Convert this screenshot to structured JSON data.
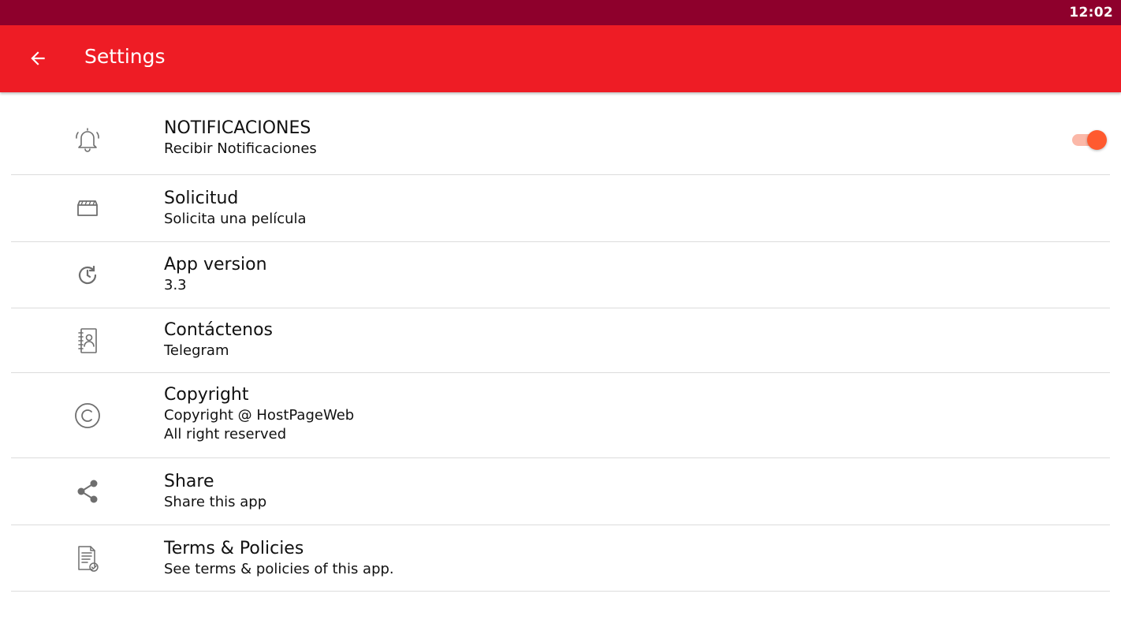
{
  "status_bar": {
    "time": "12:02"
  },
  "app_bar": {
    "back_icon": "arrow-back-icon",
    "title": "Settings"
  },
  "colors": {
    "status_bar": "#8e002c",
    "app_bar": "#ee1c25",
    "toggle_thumb": "#ff5a2f",
    "toggle_track": "#fbb8a8"
  },
  "settings": {
    "items": [
      {
        "icon": "bell-icon",
        "title": "NOTIFICACIONES",
        "subtitle": "Recibir Notificaciones",
        "toggle_on": true
      },
      {
        "icon": "movie-clapper-icon",
        "title": "Solicitud",
        "subtitle": "Solicita una película"
      },
      {
        "icon": "update-clock-icon",
        "title": "App version",
        "subtitle": "3.3"
      },
      {
        "icon": "contact-book-icon",
        "title": "Contáctenos",
        "subtitle": "Telegram"
      },
      {
        "icon": "copyright-icon",
        "title": "Copyright",
        "subtitle": "Copyright @ HostPageWeb",
        "subtitle2": "All right reserved"
      },
      {
        "icon": "share-icon",
        "title": "Share",
        "subtitle": "Share this app"
      },
      {
        "icon": "terms-document-icon",
        "title": "Terms & Policies",
        "subtitle": "See terms & policies of this app."
      }
    ]
  }
}
